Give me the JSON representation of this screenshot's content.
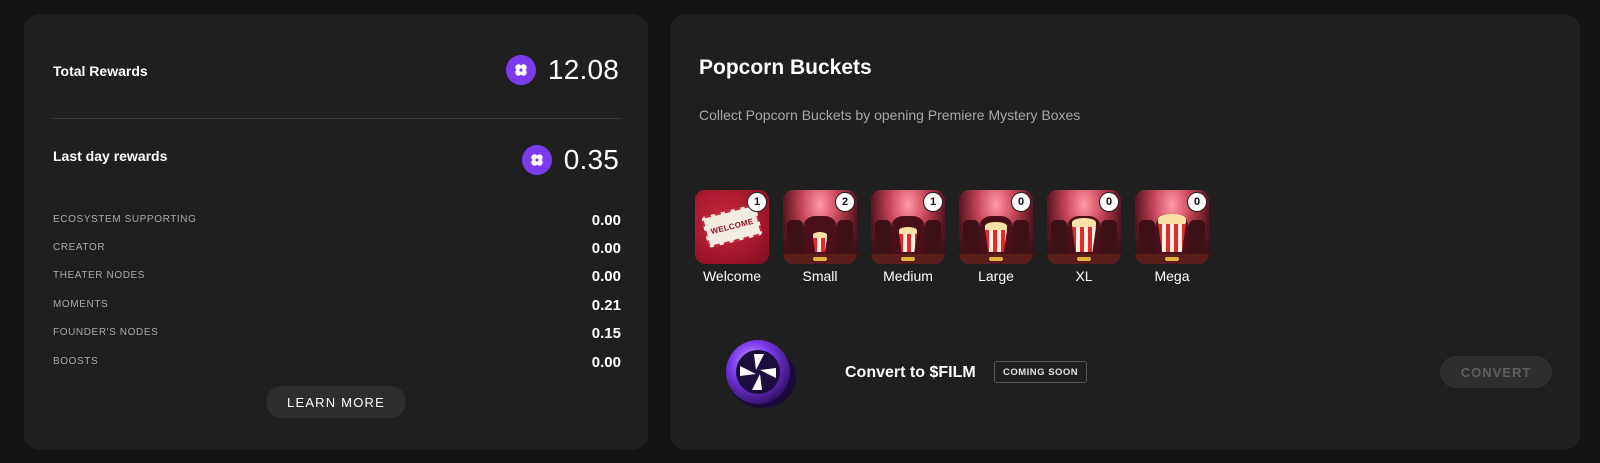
{
  "rewards": {
    "total_label": "Total Rewards",
    "total_value": "12.08",
    "last_day_label": "Last day rewards",
    "last_day_value": "0.35",
    "breakdown": [
      {
        "label": "ECOSYSTEM SUPPORTING",
        "value": "0.00"
      },
      {
        "label": "CREATOR",
        "value": "0.00"
      },
      {
        "label": "THEATER NODES",
        "value": "0.00"
      },
      {
        "label": "MOMENTS",
        "value": "0.21"
      },
      {
        "label": "FOUNDER'S NODES",
        "value": "0.15"
      },
      {
        "label": "BOOSTS",
        "value": "0.00"
      }
    ],
    "learn_more_label": "LEARN MORE",
    "token_icon": "flower-token-icon",
    "accent_color": "#7c3aed"
  },
  "buckets": {
    "title": "Popcorn Buckets",
    "subtitle": "Collect Popcorn Buckets by opening Premiere Mystery Boxes",
    "items": [
      {
        "name": "Welcome",
        "count": "1",
        "icon": "welcome-ticket-icon"
      },
      {
        "name": "Small",
        "count": "2",
        "icon": "small-popcorn-icon"
      },
      {
        "name": "Medium",
        "count": "1",
        "icon": "medium-popcorn-icon"
      },
      {
        "name": "Large",
        "count": "0",
        "icon": "large-popcorn-icon"
      },
      {
        "name": "XL",
        "count": "0",
        "icon": "xl-popcorn-icon"
      },
      {
        "name": "Mega",
        "count": "0",
        "icon": "mega-popcorn-icon"
      }
    ],
    "convert_title": "Convert to $FILM",
    "coming_soon": "COMING SOON",
    "convert_button": "CONVERT",
    "coin_icon": "film-coin-icon"
  }
}
